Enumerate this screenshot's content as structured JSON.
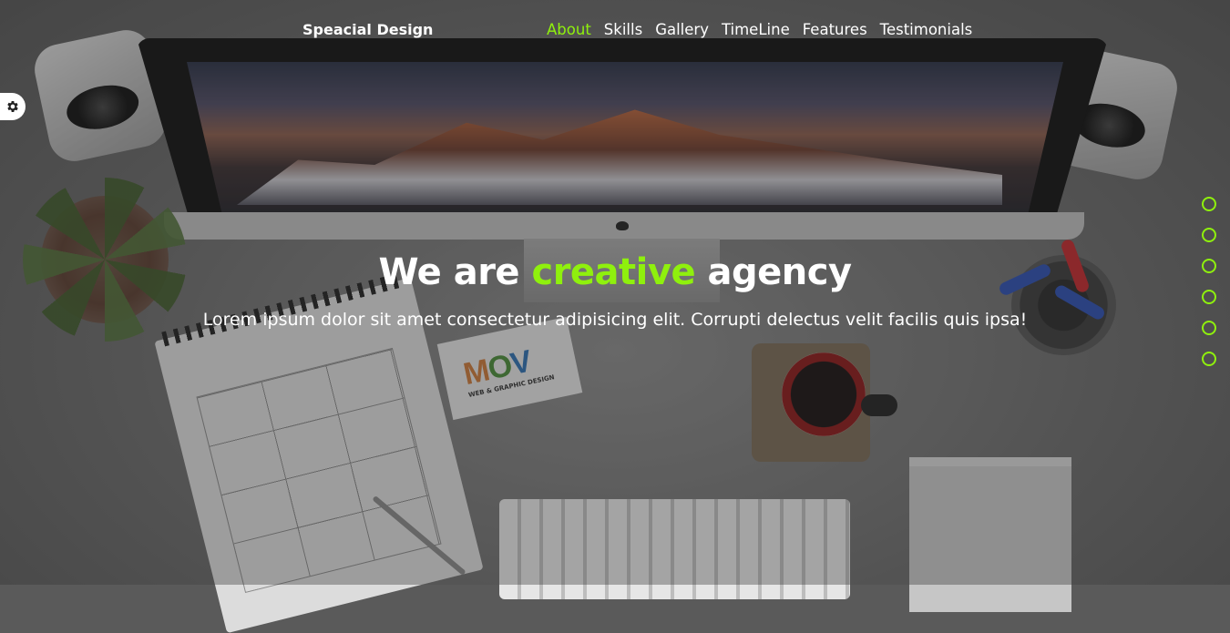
{
  "header": {
    "brand": "Speacial Design",
    "nav": [
      "About",
      "Skills",
      "Gallery",
      "TimeLine",
      "Features",
      "Testimonials"
    ],
    "active_nav": "About"
  },
  "hero": {
    "title_pre": "We are ",
    "title_accent": "creative",
    "title_post": " agency",
    "subtitle": "Lorem ipsum dolor sit amet consectetur adipisicing elit. Corrupti delectus velit facilis quis ipsa!"
  },
  "background_card": {
    "logo_m": "M",
    "logo_o": "O",
    "logo_v": "V",
    "tagline": "WEB & GRAPHIC DESIGN"
  },
  "bullets": {
    "count": 6
  },
  "icons": {
    "settings": "gear-icon"
  },
  "colors": {
    "accent": "#8ff00d",
    "text": "#ffffff"
  }
}
